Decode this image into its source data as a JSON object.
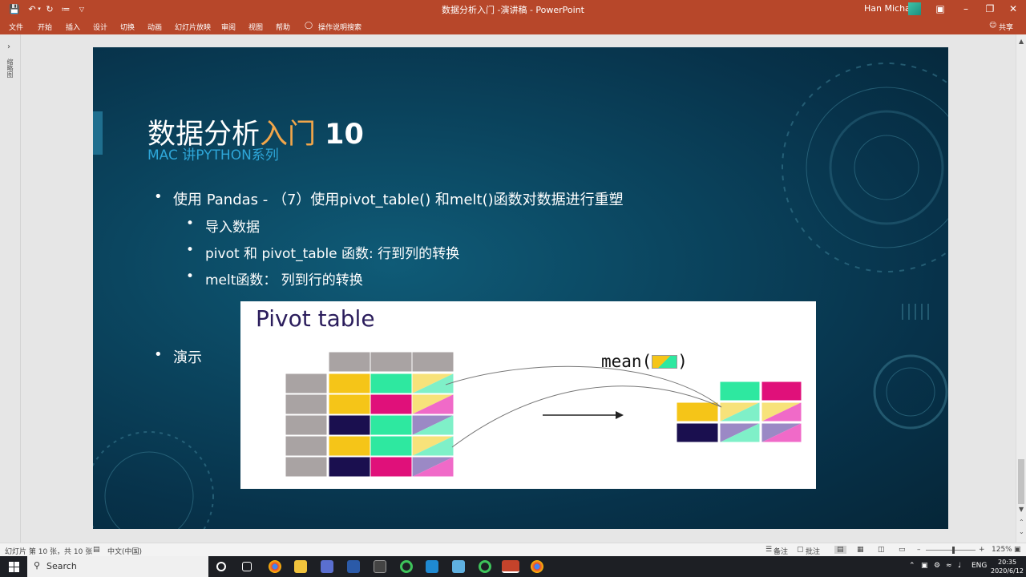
{
  "titlebar": {
    "doc_title": "数据分析入门 -演讲稿  -  PowerPoint",
    "user": "Han Michael",
    "colors": {
      "bg": "#b7472a"
    }
  },
  "menubar": {
    "items": [
      "文件",
      "开始",
      "插入",
      "设计",
      "切换",
      "动画",
      "幻灯片放映",
      "审阅",
      "视图",
      "帮助"
    ],
    "tell_me": "操作说明搜索",
    "share": "共享"
  },
  "thumbpane": {
    "label": "缩略图"
  },
  "slide": {
    "title_part1": "数据分析",
    "title_part2": "入门",
    "title_num": "10",
    "subtitle": "MAC 讲PYTHON系列",
    "bullets": [
      {
        "level": 1,
        "text": "使用 Pandas - （7）使用pivot_table() 和melt()函数对数据进行重塑"
      },
      {
        "level": 2,
        "text": "导入数据"
      },
      {
        "level": 2,
        "text": "pivot 和 pivot_table 函数: 行到列的转换"
      },
      {
        "level": 2,
        "text": "melt函数：  列到行的转换"
      },
      {
        "level": 1,
        "text": "演示"
      }
    ],
    "pivot_title": "Pivot table",
    "mean_label_start": "mean(",
    "mean_label_end": ")",
    "colors": {
      "yellow": "#f5c518",
      "green": "#2ee8a0",
      "magenta": "#e0107a",
      "navy": "#1a0f4f",
      "grey": "#a9a3a3",
      "lavender": "#9b89c5",
      "pink": "#f06ac8",
      "mint": "#7ff0c8",
      "paleyellow": "#f7e27a"
    }
  },
  "statusbar": {
    "slide_info": "幻灯片 第 10 张，共 10 张",
    "language": "中文(中国)",
    "notes": "备注",
    "comments": "批注",
    "zoom": "125%"
  },
  "taskbar": {
    "search_placeholder": "Search",
    "lang": "ENG",
    "time": "20:35",
    "date": "2020/6/12"
  }
}
